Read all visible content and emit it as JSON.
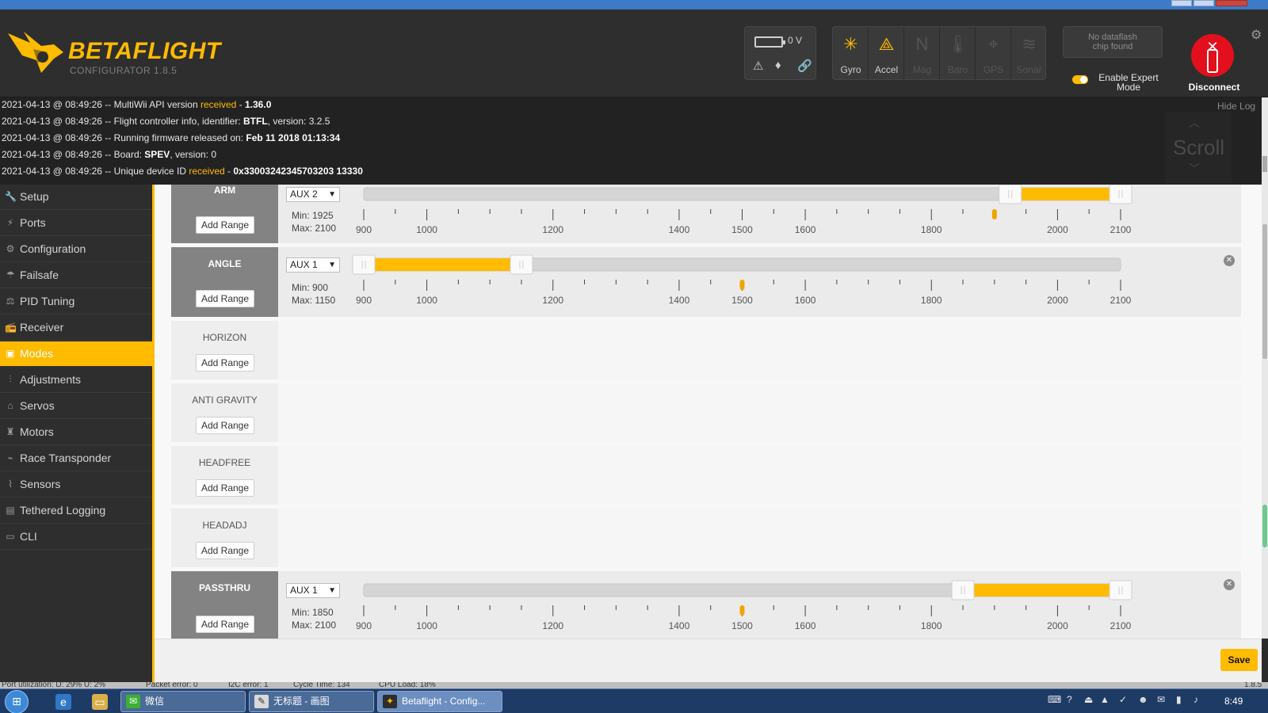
{
  "window": {
    "controls": [
      "–",
      "□",
      "✕"
    ]
  },
  "header": {
    "logo_title": "BETAFLIGHT",
    "logo_subtitle": "CONFIGURATOR  1.8.5",
    "battery_voltage": "0 V",
    "sensors": [
      {
        "label": "Gyro",
        "icon": "gyro-icon",
        "active": true
      },
      {
        "label": "Accel",
        "icon": "accel-icon",
        "active": true
      },
      {
        "label": "Mag",
        "icon": "mag-icon",
        "active": false
      },
      {
        "label": "Baro",
        "icon": "baro-icon",
        "active": false
      },
      {
        "label": "GPS",
        "icon": "gps-icon",
        "active": false
      },
      {
        "label": "Sonar",
        "icon": "sonar-icon",
        "active": false
      }
    ],
    "dataflash_line1": "No dataflash",
    "dataflash_line2": "chip found",
    "expert_line1": "Enable Expert",
    "expert_line2": "Mode",
    "disconnect_label": "Disconnect",
    "accent_color": "#ffbb00",
    "disconnect_color": "#e2101c"
  },
  "log": {
    "hide_label": "Hide Log",
    "scroll_label": "Scroll",
    "lines": [
      {
        "prefix": "2021-04-13 @ 08:49:26 -- MultiWii API version ",
        "hl": "received",
        "mid": " - ",
        "bold": "1.36.0",
        "tail": ""
      },
      {
        "prefix": "2021-04-13 @ 08:49:26 -- Flight controller info, identifier: ",
        "hl": "",
        "mid": "",
        "bold": "BTFL",
        "tail": ", version: 3.2.5"
      },
      {
        "prefix": "2021-04-13 @ 08:49:26 -- Running firmware released on: ",
        "hl": "",
        "mid": "",
        "bold": "Feb 11 2018 01:13:34",
        "tail": ""
      },
      {
        "prefix": "2021-04-13 @ 08:49:26 -- Board: ",
        "hl": "",
        "mid": "",
        "bold": "SPEV",
        "tail": ", version: 0"
      },
      {
        "prefix": "2021-04-13 @ 08:49:26 -- Unique device ID ",
        "hl": "received",
        "mid": " - ",
        "bold": "0x33003242345703203 13330",
        "tail": ""
      }
    ]
  },
  "sidebar": {
    "items": [
      {
        "label": "Setup",
        "icon": "wrench-icon",
        "glyph": "🔧"
      },
      {
        "label": "Ports",
        "icon": "plug-icon",
        "glyph": "⚡"
      },
      {
        "label": "Configuration",
        "icon": "gear-icon",
        "glyph": "⚙"
      },
      {
        "label": "Failsafe",
        "icon": "parachute-icon",
        "glyph": "☂"
      },
      {
        "label": "PID Tuning",
        "icon": "pid-icon",
        "glyph": "⚖"
      },
      {
        "label": "Receiver",
        "icon": "receiver-icon",
        "glyph": "📻"
      },
      {
        "label": "Modes",
        "icon": "modes-icon",
        "glyph": "▣",
        "active": true
      },
      {
        "label": "Adjustments",
        "icon": "sliders-icon",
        "glyph": "⫶"
      },
      {
        "label": "Servos",
        "icon": "servo-icon",
        "glyph": "⌂"
      },
      {
        "label": "Motors",
        "icon": "motor-icon",
        "glyph": "♜"
      },
      {
        "label": "Race Transponder",
        "icon": "transponder-icon",
        "glyph": "⌁"
      },
      {
        "label": "Sensors",
        "icon": "sensors-icon",
        "glyph": "⌇"
      },
      {
        "label": "Tethered Logging",
        "icon": "logging-icon",
        "glyph": "▤"
      },
      {
        "label": "CLI",
        "icon": "cli-icon",
        "glyph": "▭"
      }
    ]
  },
  "modes": {
    "ticks": [
      900,
      1000,
      1200,
      1400,
      1500,
      1600,
      1800,
      2000,
      2100
    ],
    "add_range_label": "Add Range",
    "items": [
      {
        "name": "ARM",
        "aux": "AUX 2",
        "min": 1925,
        "max": 2100,
        "min_label": "Min: 1925",
        "max_label": "Max: 2100",
        "marker": 1900,
        "ranged": true
      },
      {
        "name": "ANGLE",
        "aux": "AUX 1",
        "min": 900,
        "max": 1150,
        "min_label": "Min: 900",
        "max_label": "Max: 1150",
        "marker": 1500,
        "ranged": true
      },
      {
        "name": "HORIZON",
        "ranged": false
      },
      {
        "name": "ANTI GRAVITY",
        "ranged": false
      },
      {
        "name": "HEADFREE",
        "ranged": false
      },
      {
        "name": "HEADADJ",
        "ranged": false
      },
      {
        "name": "PASSTHRU",
        "aux": "AUX 1",
        "min": 1850,
        "max": 2100,
        "min_label": "Min: 1850",
        "max_label": "Max: 2100",
        "marker": 1500,
        "ranged": true
      }
    ]
  },
  "footer": {
    "save_label": "Save"
  },
  "status": {
    "items": [
      "Port utilization: D: 29% U: 2%",
      "Packet error: 0",
      "I2C error: 1",
      "Cycle Time: 134",
      "CPU Load: 18%"
    ],
    "version": "1.8.5"
  },
  "taskbar": {
    "apps": [
      {
        "label": "微信",
        "icon": "wechat-icon"
      },
      {
        "label": "无标题 - 画图",
        "icon": "paint-icon"
      },
      {
        "label": "Betaflight - Config...",
        "icon": "betaflight-icon",
        "active": true
      }
    ],
    "clock": "8:49"
  }
}
